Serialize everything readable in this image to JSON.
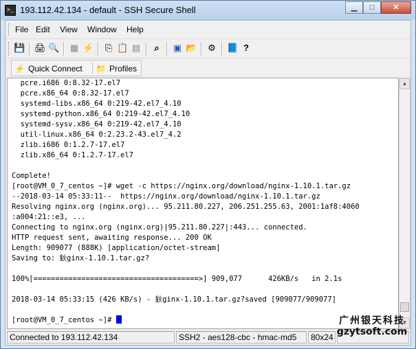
{
  "window": {
    "title": "193.112.42.134 - default - SSH Secure Shell",
    "app_icon_glyph": ">_",
    "minimize_glyph": "▁",
    "maximize_glyph": "□",
    "close_glyph": "✕"
  },
  "menu": {
    "items": [
      "File",
      "Edit",
      "View",
      "Window",
      "Help"
    ]
  },
  "toolbar": {
    "icons": [
      "save-icon",
      "print-icon",
      "print-preview-icon",
      "disconnect-icon",
      "connect-icon",
      "copy-icon",
      "paste-icon",
      "paste-special-icon",
      "find-icon",
      "new-terminal-icon",
      "new-file-transfer-icon",
      "settings-icon",
      "help-topics-icon",
      "context-help-icon"
    ],
    "glyphs": [
      "💾",
      "🖨",
      "🔍",
      "▦",
      "⚡",
      "⎘",
      "📋",
      "▤",
      "⌕",
      "▣",
      "📂",
      "⚙",
      "📘",
      "?"
    ]
  },
  "quickbar": {
    "quick_connect_label": "Quick Connect",
    "profiles_label": "Profiles",
    "quick_connect_glyph": "⚡",
    "profiles_glyph": "📁"
  },
  "terminal": {
    "lines": [
      "  pcre.i686 0:8.32-17.el7",
      "  pcre.x86_64 0:8.32-17.el7",
      "  systemd-libs.x86_64 0:219-42.el7_4.10",
      "  systemd-python.x86_64 0:219-42.el7_4.10",
      "  systemd-sysv.x86_64 0:219-42.el7_4.10",
      "  util-linux.x86_64 0:2.23.2-43.el7_4.2",
      "  zlib.i686 0:1.2.7-17.el7",
      "  zlib.x86_64 0:1.2.7-17.el7",
      "",
      "Complete!",
      "[root@VM_0_7_centos ~]# wget -c https://nginx.org/download/nginx-1.10.1.tar.gz",
      "--2018-03-14 05:33:11--  https://nginx.org/download/nginx-1.10.1.tar.gz",
      "Resolving nginx.org (nginx.org)... 95.211.80.227, 206.251.255.63, 2001:1af8:4060",
      ":a004:21::e3, ...",
      "Connecting to nginx.org (nginx.org)|95.211.80.227|:443... connected.",
      "HTTP request sent, awaiting response... 200 OK",
      "Length: 909077 (888K) [application/octet-stream]",
      "Saving to: 鈥ginx-1.10.1.tar.gz?",
      "",
      "100%[======================================>] 909,077      426KB/s   in 2.1s",
      "",
      "2018-03-14 05:33:15 (426 KB/s) - 鈥ginx-1.10.1.tar.gz?saved [909077/909077]",
      "",
      "[root@VM_0_7_centos ~]# "
    ]
  },
  "scrollbar": {
    "up_glyph": "▲",
    "down_glyph": "▼",
    "position_fraction": 0.97
  },
  "status": {
    "connection": "Connected to 193.112.42.134",
    "cipher": "SSH2 - aes128-cbc - hmac-md5",
    "size": "80x24"
  },
  "watermark": {
    "line1": "广州银天科技",
    "line2": "gzytsoft.com"
  }
}
